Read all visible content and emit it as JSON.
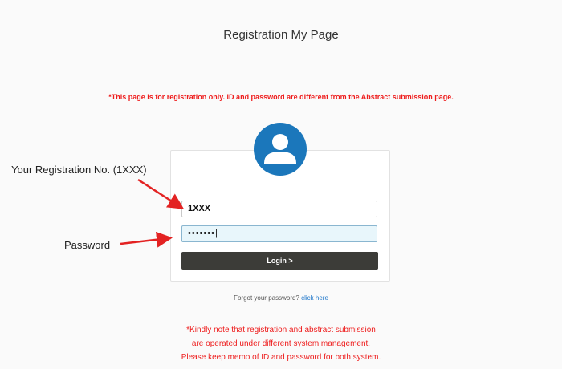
{
  "header": {
    "title": "Registration My Page"
  },
  "notice_top": "*This page is for registration only. ID and password are different from the Abstract submission page.",
  "form": {
    "registration_no_value": "1XXX",
    "password_value": "•••••••|",
    "login_label": "Login >"
  },
  "forgot": {
    "text": "Forgot your password?",
    "link": "click here"
  },
  "notice_bottom": [
    "*Kindly note that registration and abstract submission",
    "are operated under different system management.",
    "Please keep memo of ID and password for both system."
  ],
  "annotations": {
    "registration_label": "Your Registration No. (1XXX)",
    "password_label": "Password"
  },
  "colors": {
    "accent_blue": "#1b77bb",
    "notice_red": "#ee1c1c",
    "button_dark": "#3c3c38",
    "arrow_red": "#e32222"
  },
  "icons": [
    "user-avatar-icon",
    "arrow-icon"
  ]
}
